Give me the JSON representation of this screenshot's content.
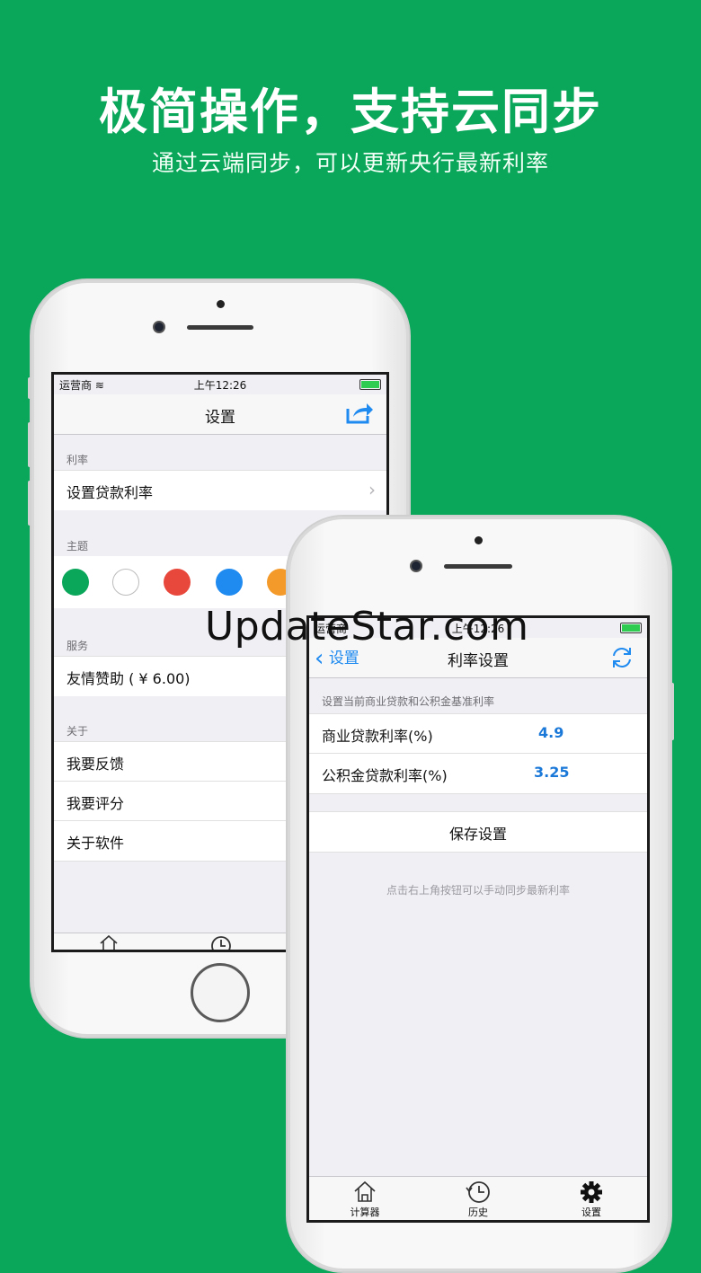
{
  "headline": "极简操作，支持云同步",
  "subline": "通过云端同步，可以更新央行最新利率",
  "watermark": "UpdateStar.com",
  "back_phone": {
    "status": {
      "carrier": "运营商",
      "time": "上午12:26"
    },
    "nav_title": "设置",
    "share_icon": "share-icon",
    "sections": {
      "rate_header": "利率",
      "rate_cell": "设置贷款利率",
      "theme_header": "主题",
      "theme_colors": [
        "#0aa65a",
        "#ffffff",
        "#e8473b",
        "#1f8af0",
        "#f39a2b"
      ],
      "service_header": "服务",
      "donate_cell": "友情赞助 ( ¥ 6.00)",
      "about_header": "关于",
      "feedback_cell": "我要反馈",
      "rate_app_cell": "我要评分",
      "about_cell": "关于软件"
    }
  },
  "front_phone": {
    "status": {
      "carrier": "运营商",
      "time": "上午12:26"
    },
    "nav_back": "设置",
    "nav_title": "利率设置",
    "refresh_icon": "refresh-icon",
    "section_header": "设置当前商业贷款和公积金基准利率",
    "rows": [
      {
        "label": "商业贷款利率(%)",
        "value": "4.9"
      },
      {
        "label": "公积金贷款利率(%)",
        "value": "3.25"
      }
    ],
    "save_button": "保存设置",
    "hint": "点击右上角按钮可以手动同步最新利率",
    "tabs": [
      {
        "label": "计算器",
        "icon": "home-icon"
      },
      {
        "label": "历史",
        "icon": "clock-icon"
      },
      {
        "label": "设置",
        "icon": "gear-icon"
      }
    ]
  }
}
